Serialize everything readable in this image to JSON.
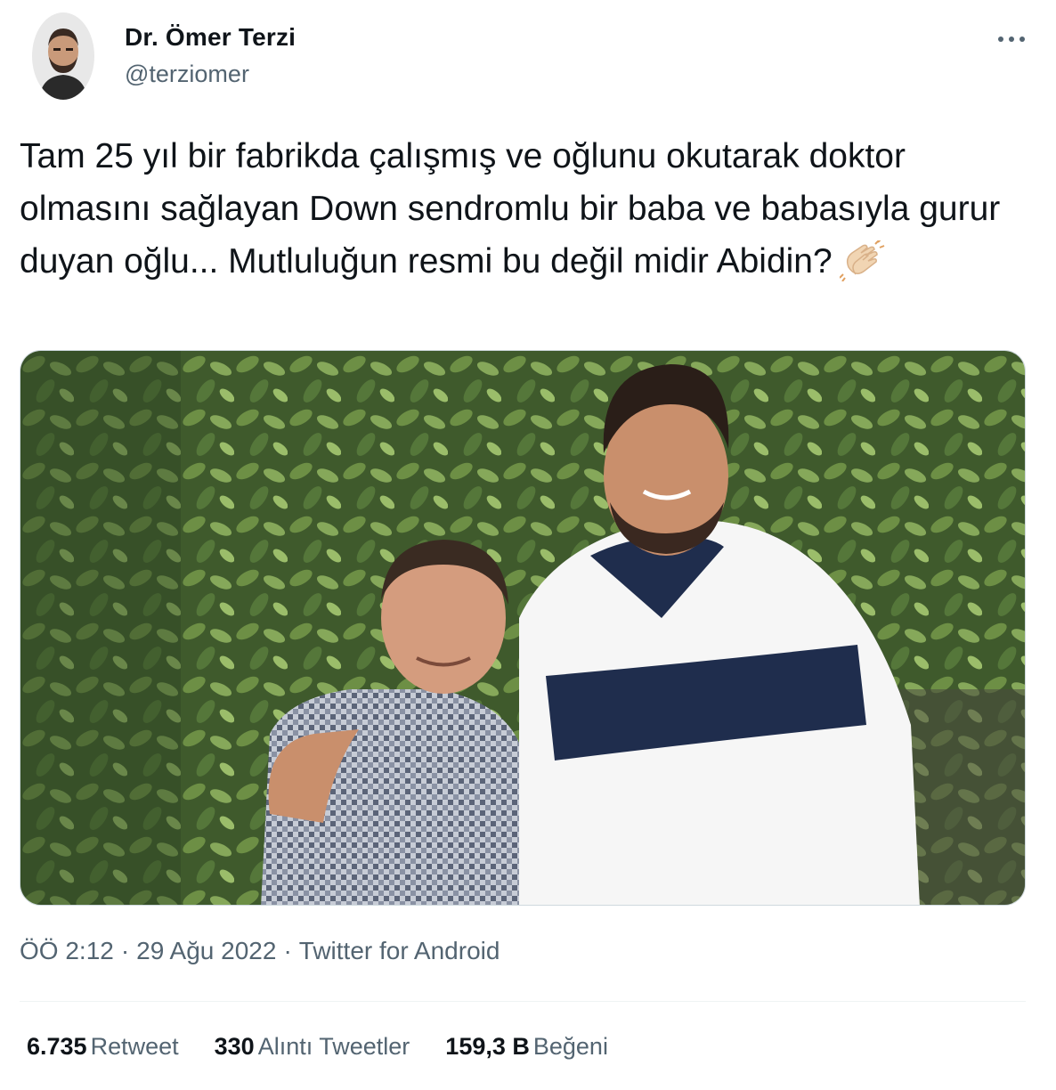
{
  "author": {
    "display_name": "Dr. Ömer Terzi",
    "handle": "@terziomer",
    "avatar_icon": "profile-photo"
  },
  "more_icon": "more-horizontal-icon",
  "tweet": {
    "text": "Tam 25 yıl bir fabrikda çalışmış ve oğlunu okutarak doktor olmasını sağlayan Down sendromlu bir baba ve babasıyla gurur duyan oğlu... Mutluluğun resmi bu değil midir Abidin?",
    "emoji": "clapping-hands"
  },
  "meta": {
    "time": "ÖÖ 2:12",
    "separator": "·",
    "date": "29 Ağu 2022",
    "source": "Twitter for Android"
  },
  "stats": {
    "retweets": {
      "value": "6.735",
      "label": "Retweet"
    },
    "quotes": {
      "value": "330",
      "label": "Alıntı Tweetler"
    },
    "likes": {
      "value": "159,3 B",
      "label": "Beğeni"
    }
  },
  "colors": {
    "text_primary": "#0f1419",
    "text_secondary": "#536471",
    "border": "#cfd9de"
  }
}
